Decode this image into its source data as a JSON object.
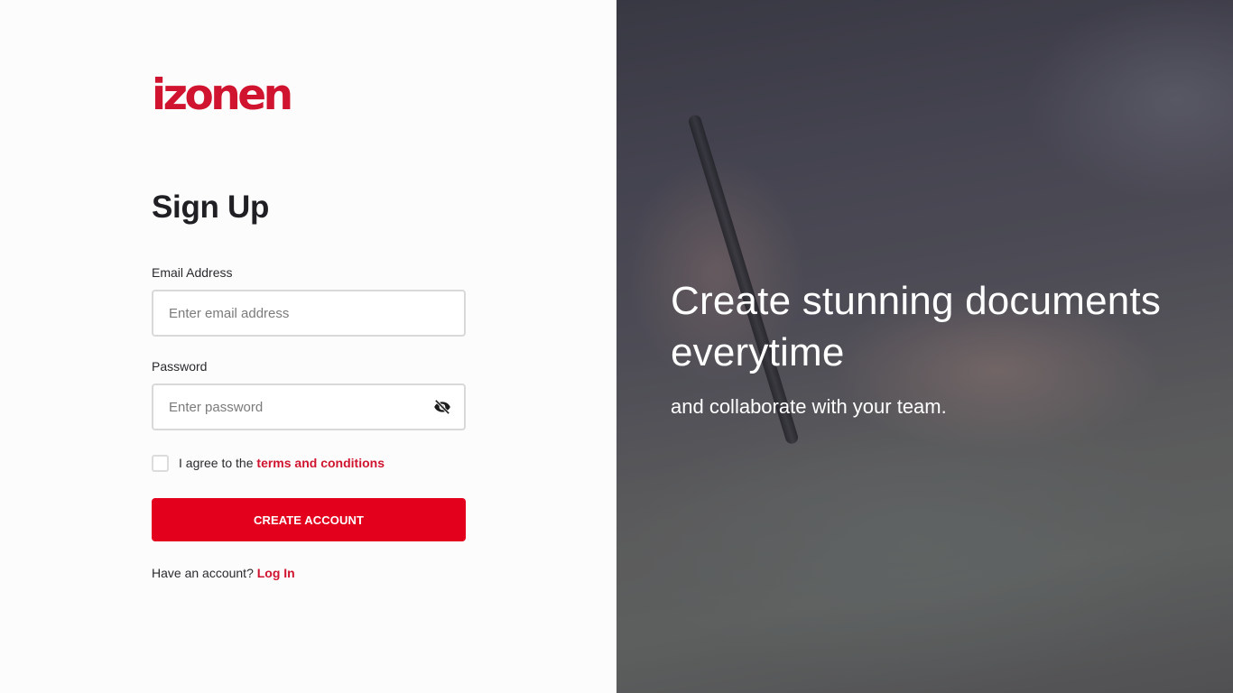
{
  "brand": {
    "logo_text": "izonen",
    "accent_color": "#e2001d"
  },
  "form": {
    "title": "Sign Up",
    "email": {
      "label": "Email Address",
      "placeholder": "Enter email address"
    },
    "password": {
      "label": "Password",
      "placeholder": "Enter password",
      "toggle_icon": "eye-off-icon"
    },
    "terms": {
      "prefix": "I agree to the ",
      "link_text": "terms and conditions",
      "checked": false
    },
    "submit_label": "CREATE ACCOUNT",
    "login_prompt": {
      "text": "Have an account? ",
      "link_text": "Log In"
    }
  },
  "hero": {
    "headline": "Create stunning documents everytime",
    "subtext": "and collaborate with your team."
  }
}
